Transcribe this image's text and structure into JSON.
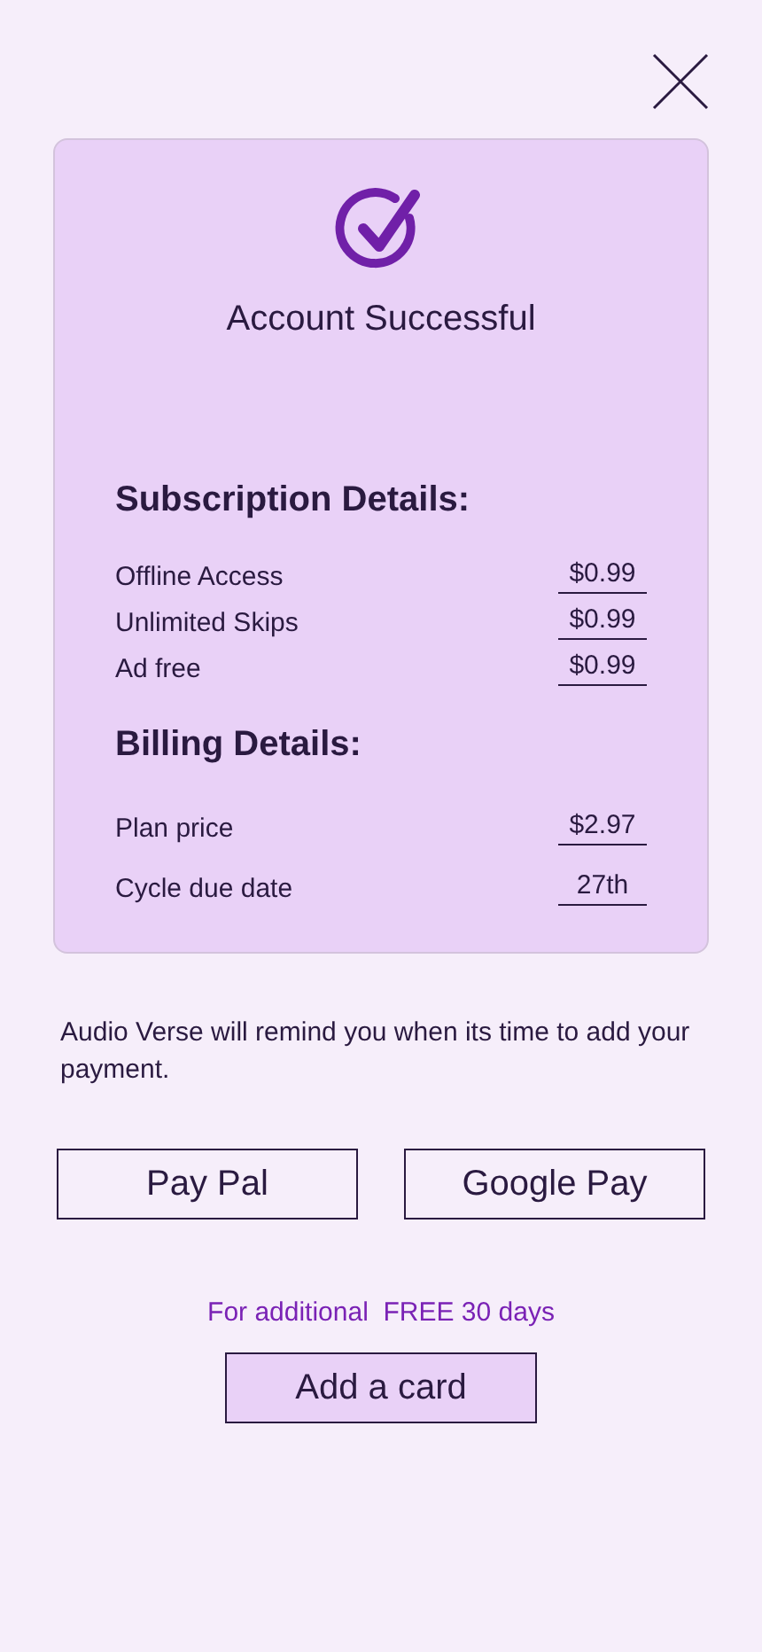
{
  "card": {
    "title": "Account Successful",
    "subscription": {
      "heading": "Subscription Details:",
      "rows": [
        {
          "label": "Offline Access",
          "value": "$0.99"
        },
        {
          "label": "Unlimited Skips",
          "value": "$0.99"
        },
        {
          "label": "Ad free",
          "value": "$0.99"
        }
      ]
    },
    "billing": {
      "heading": "Billing Details:",
      "rows": [
        {
          "label": "Plan price",
          "value": "$2.97"
        },
        {
          "label": "Cycle due date",
          "value": "27th"
        }
      ]
    }
  },
  "notice": "Audio Verse will remind you when its time to add your payment.",
  "payment_buttons": [
    "Pay Pal",
    "Google Pay"
  ],
  "offer": "For additional  FREE 30 days",
  "add_card_button": "Add a card"
}
